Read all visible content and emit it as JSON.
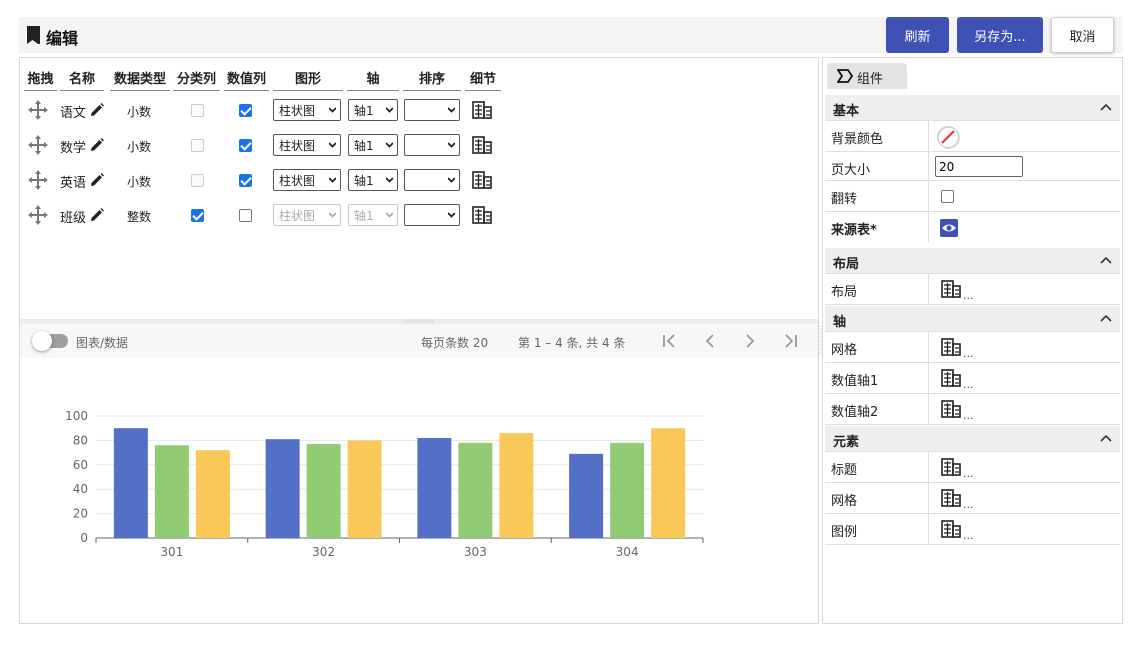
{
  "header": {
    "title": "编辑",
    "buttons": {
      "refresh": "刷新",
      "save_as": "另存为...",
      "cancel": "取消"
    }
  },
  "table": {
    "columns": [
      "拖拽",
      "名称",
      "数据类型",
      "分类列",
      "数值列",
      "图形",
      "轴",
      "排序",
      "细节"
    ],
    "rows": [
      {
        "name": "语文",
        "type": "小数",
        "category": false,
        "category_disabled": true,
        "value": true,
        "shape": "柱状图",
        "axis": "轴1",
        "sort": "",
        "disabled": false
      },
      {
        "name": "数学",
        "type": "小数",
        "category": false,
        "category_disabled": true,
        "value": true,
        "shape": "柱状图",
        "axis": "轴1",
        "sort": "",
        "disabled": false
      },
      {
        "name": "英语",
        "type": "小数",
        "category": false,
        "category_disabled": true,
        "value": true,
        "shape": "柱状图",
        "axis": "轴1",
        "sort": "",
        "disabled": false
      },
      {
        "name": "班级",
        "type": "整数",
        "category": true,
        "category_disabled": false,
        "value": false,
        "shape": "柱状图",
        "axis": "轴1",
        "sort": "",
        "disabled": true
      }
    ]
  },
  "toolbar": {
    "toggle_label": "图表/数据",
    "page_size": "每页条数 20",
    "page_info": "第 1 – 4 条, 共 4 条"
  },
  "colors": {
    "primary": "#3f51b5",
    "series1": "#5470c6",
    "series2": "#91cc75",
    "series3": "#fac858",
    "checkbox": "#1a73e8"
  },
  "chart_data": {
    "type": "bar",
    "categories": [
      "301",
      "302",
      "303",
      "304"
    ],
    "series": [
      {
        "name": "",
        "values": [
          90,
          81,
          82,
          69
        ]
      },
      {
        "name": "",
        "values": [
          76,
          77,
          78,
          78
        ]
      },
      {
        "name": "",
        "values": [
          72,
          80,
          86,
          90
        ]
      }
    ],
    "ylim": [
      0,
      100
    ],
    "yticks": [
      0,
      20,
      40,
      60,
      80,
      100
    ],
    "grid": true
  },
  "side": {
    "tab": "组件",
    "sections": {
      "basic": "基本",
      "layout": "布局",
      "axis": "轴",
      "elements": "元素"
    },
    "basic": {
      "bg_color_label": "背景颜色",
      "page_size_label": "页大小",
      "page_size_value": "20",
      "flip_label": "翻转",
      "source_label": "来源表*"
    },
    "layout_items": [
      "布局"
    ],
    "axis_items": [
      "网格",
      "数值轴1",
      "数值轴2"
    ],
    "element_items": [
      "标题",
      "网格",
      "图例"
    ],
    "dots": "..."
  }
}
